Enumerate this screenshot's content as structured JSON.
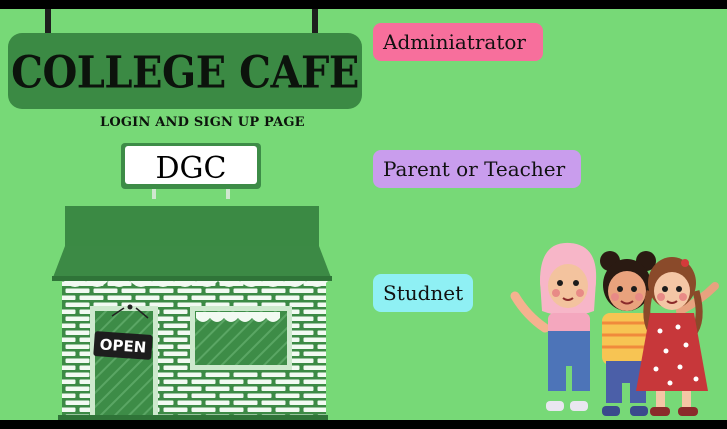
{
  "header": {
    "sign_title": "COLLEGE CAFE",
    "subtitle": "LOGIN AND SIGN UP PAGE"
  },
  "building": {
    "name": "DGC",
    "door_sign": "OPEN"
  },
  "roles": {
    "admin_label": "Adminiatrator",
    "parent_label": "Parent or Teacher",
    "student_label": "Studnet"
  },
  "colors": {
    "background": "#77d977",
    "sign": "#3b8a44",
    "admin": "#f76f9c",
    "parent": "#c99ded",
    "student": "#8ff0f4"
  }
}
